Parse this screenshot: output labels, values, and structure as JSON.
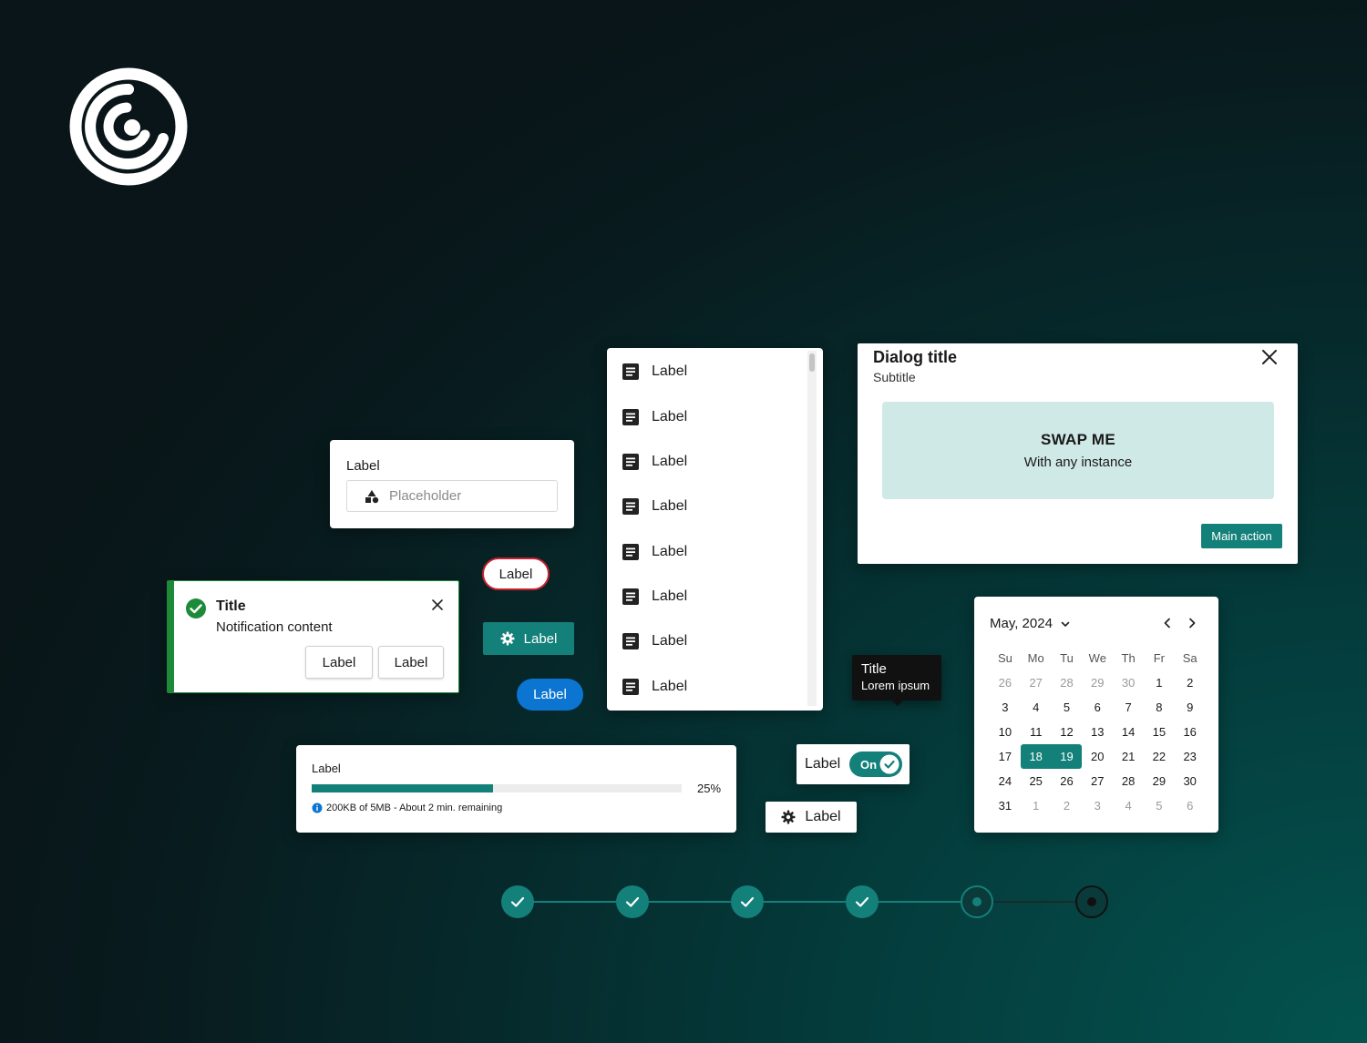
{
  "field": {
    "label": "Label",
    "placeholder": "Placeholder",
    "icon": "shapes-icon"
  },
  "notification": {
    "title": "Title",
    "content": "Notification content",
    "actions": [
      "Label",
      "Label"
    ],
    "status_color": "#1d8a3a"
  },
  "buttons": {
    "pill_outline": "Label",
    "teal_icon": "Label",
    "blue_pill": "Label",
    "gear_outline": "Label"
  },
  "list": {
    "items": [
      "Label",
      "Label",
      "Label",
      "Label",
      "Label",
      "Label",
      "Label",
      "Label"
    ],
    "item_icon": "document-icon"
  },
  "dialog": {
    "title": "Dialog title",
    "subtitle": "Subtitle",
    "slot_title": "SWAP ME",
    "slot_subtitle": "With any instance",
    "main_action": "Main action"
  },
  "tooltip": {
    "title": "Title",
    "body": "Lorem ipsum"
  },
  "calendar": {
    "month": "May, 2024",
    "weekdays": [
      "Su",
      "Mo",
      "Tu",
      "We",
      "Th",
      "Fr",
      "Sa"
    ],
    "weeks": [
      [
        "26",
        "27",
        "28",
        "29",
        "30",
        "1",
        "2"
      ],
      [
        "3",
        "4",
        "5",
        "6",
        "7",
        "8",
        "9"
      ],
      [
        "10",
        "11",
        "12",
        "13",
        "14",
        "15",
        "16"
      ],
      [
        "17",
        "18",
        "19",
        "20",
        "21",
        "22",
        "23"
      ],
      [
        "24",
        "25",
        "26",
        "27",
        "28",
        "29",
        "30"
      ],
      [
        "31",
        "1",
        "2",
        "3",
        "4",
        "5",
        "6"
      ]
    ],
    "selected": [
      "18",
      "19"
    ]
  },
  "progress": {
    "label": "Label",
    "percent_text": "25%",
    "fill_fraction": 0.49,
    "info": "200KB of 5MB - About 2 min. remaining"
  },
  "toggle": {
    "label": "Label",
    "state": "On"
  },
  "stepper": {
    "completed_steps": 4,
    "current_step": 5,
    "total_steps": 6
  },
  "colors": {
    "accent": "#14807a",
    "danger": "#c8202f",
    "primary_blue": "#0b75d1",
    "success": "#1d8a3a"
  }
}
